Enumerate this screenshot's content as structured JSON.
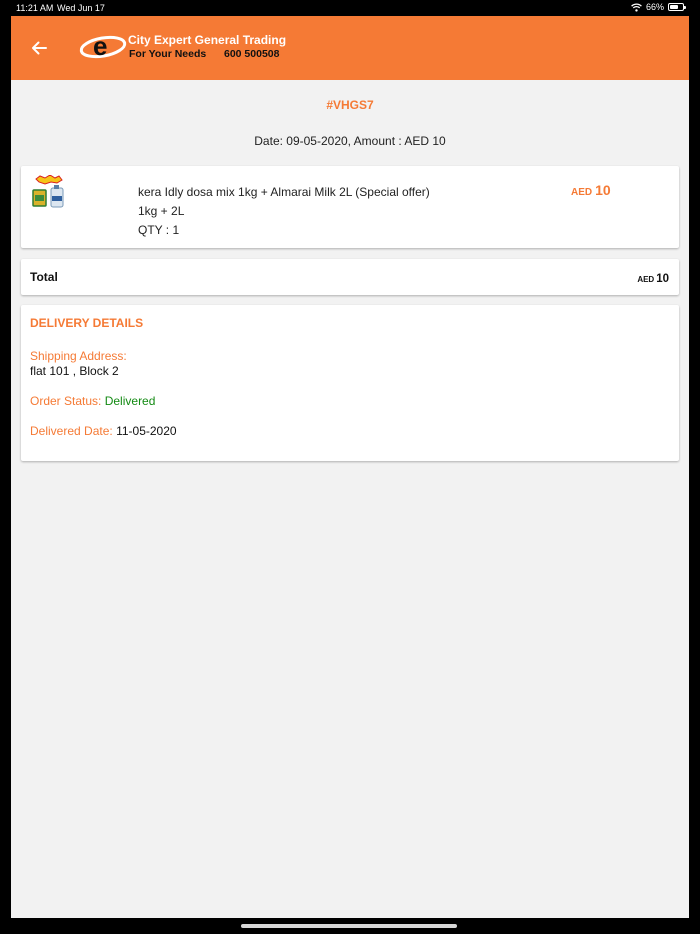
{
  "status_bar": {
    "time": "11:21 AM",
    "date": "Wed Jun 17",
    "battery": "66%",
    "battery_level": 0.66,
    "wifi_icon": "wifi-icon"
  },
  "header": {
    "back_icon": "arrow-left-icon",
    "logo_letter": "e",
    "brand_name": "City Expert General Trading",
    "tagline": "For Your Needs",
    "phone": "600 500508",
    "color": "#f57a35"
  },
  "order": {
    "id": "#VHGS7",
    "summary": "Date: 09-05-2020, Amount : AED 10"
  },
  "item": {
    "name": "kera Idly dosa mix 1kg + Almarai Milk 2L (Special offer)",
    "size": "1kg + 2L",
    "qty": "QTY : 1",
    "currency": "AED",
    "price": "10"
  },
  "total": {
    "label": "Total",
    "currency": "AED",
    "amount": "10"
  },
  "delivery": {
    "title": "DELIVERY DETAILS",
    "shipping_label": "Shipping Address:",
    "shipping_value": "flat 101 , Block 2",
    "status_label": "Order Status:",
    "status_value": "Delivered",
    "status_color": "#138a13",
    "date_label": "Delivered Date:",
    "date_value": "11-05-2020"
  }
}
